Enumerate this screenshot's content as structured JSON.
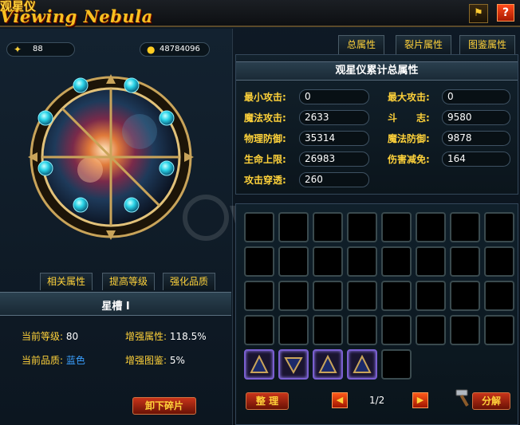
{
  "header": {
    "title_cn": "观星仪",
    "title_en": "Viewing Nebula",
    "settings_icon": "flag-icon",
    "help_label": "?"
  },
  "currency": {
    "stars": "88",
    "gold": "48784096"
  },
  "left_tabs": [
    "相关属性",
    "提高等级",
    "强化品质"
  ],
  "slot": {
    "name": "星槽 Ⅰ",
    "level_label": "当前等级:",
    "level_value": "80",
    "quality_label": "当前品质:",
    "quality_value": "蓝色",
    "boost_label": "增强属性:",
    "boost_value": "118.5%",
    "codex_label": "增强图鉴:",
    "codex_value": "5%"
  },
  "unequip_label": "卸下碎片",
  "right_tabs": [
    "总属性",
    "裂片属性",
    "图鉴属性"
  ],
  "stats": {
    "header": "观星仪累计总属性",
    "items": [
      {
        "label": "最小攻击:",
        "value": "0"
      },
      {
        "label": "最大攻击:",
        "value": "0"
      },
      {
        "label": "魔法攻击:",
        "value": "2633"
      },
      {
        "label": "斗　　志:",
        "value": "9580"
      },
      {
        "label": "物理防御:",
        "value": "35314"
      },
      {
        "label": "魔法防御:",
        "value": "9878"
      },
      {
        "label": "生命上限:",
        "value": "26983"
      },
      {
        "label": "伤害减免:",
        "value": "164"
      },
      {
        "label": "攻击穿透:",
        "value": "260"
      }
    ]
  },
  "bag": {
    "sort_label": "整 理",
    "page": "1/2",
    "decompose_label": "分解",
    "filled_slots": 4
  },
  "colors": {
    "accent": "#ffd23a",
    "blue": "#3aa0ff",
    "orb": "#2ad4e8"
  }
}
